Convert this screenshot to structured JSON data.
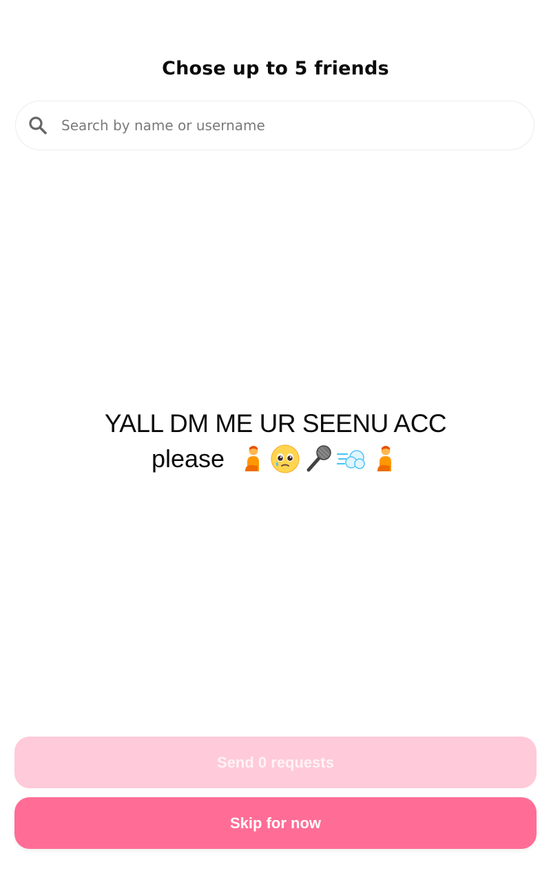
{
  "header": {
    "title": "Chose up to 5 friends"
  },
  "search": {
    "placeholder": "Search by name or username",
    "value": ""
  },
  "story": {
    "line1": "YALL DM ME UR SEENU ACC",
    "line2_text": "please",
    "line2_emojis": [
      "person-icon",
      "pleading-face-icon",
      "microphone-icon",
      "dash-icon",
      "person-icon"
    ]
  },
  "actions": {
    "send_label": "Send 0 requests",
    "skip_label": "Skip for now"
  },
  "colors": {
    "accent": "#ff6d96",
    "accent_disabled": "#ffcad9"
  }
}
